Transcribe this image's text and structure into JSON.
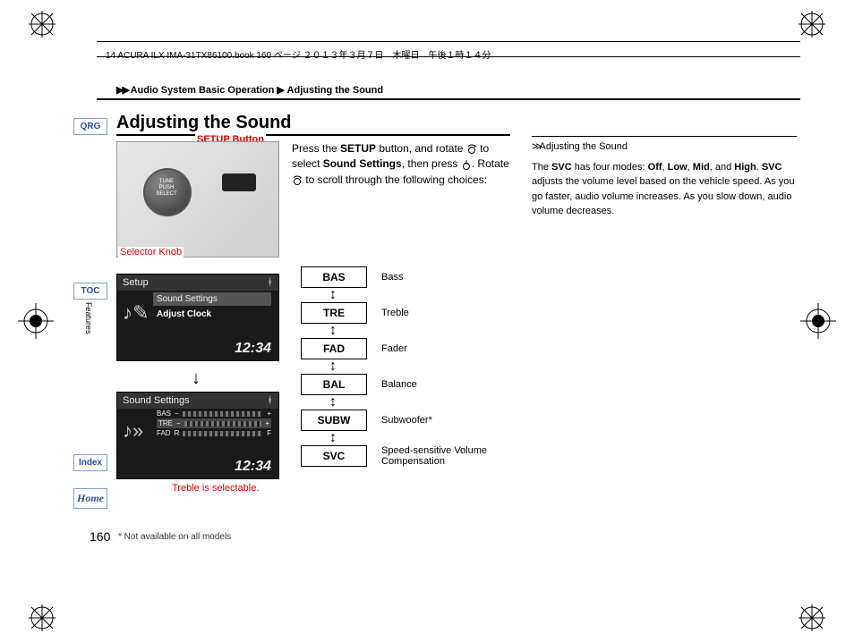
{
  "header_line": "14 ACURA ILX IMA-31TX86100.book  160 ページ  ２０１３年３月７日　木曜日　午後１時１４分",
  "breadcrumb": {
    "arrows": "▶▶",
    "a": "Audio System Basic Operation",
    "b": "Adjusting the Sound"
  },
  "nav": {
    "qrg": "QRG",
    "toc": "TOC",
    "index": "Index",
    "home": "Home",
    "side": "Features"
  },
  "title": "Adjusting the Sound",
  "labels": {
    "setup": "SETUP Button",
    "selector": "Selector Knob",
    "treble_note": "Treble is selectable."
  },
  "screens": {
    "setup": {
      "title": "Setup",
      "item_hl": "Sound Settings",
      "item_bold": "Adjust Clock",
      "time": "12:34"
    },
    "sound": {
      "title": "Sound Settings",
      "rows": [
        "BAS",
        "TRE",
        "FAD"
      ],
      "time": "12:34"
    }
  },
  "body": {
    "l1a": "Press the ",
    "l1b": "SETUP",
    "l1c": " button, and rotate ",
    "l2a": " to select ",
    "l2b": "Sound Settings",
    "l2c": ", then press ",
    "l3a": ". Rotate ",
    "l3b": " to scroll through the following choices:"
  },
  "flow": [
    {
      "code": "BAS",
      "label": "Bass"
    },
    {
      "code": "TRE",
      "label": "Treble"
    },
    {
      "code": "FAD",
      "label": "Fader"
    },
    {
      "code": "BAL",
      "label": "Balance"
    },
    {
      "code": "SUBW",
      "label": "Subwoofer*"
    },
    {
      "code": "SVC",
      "label": "Speed-sensitive Volume Compensation"
    }
  ],
  "sidebar": {
    "head": "Adjusting the Sound",
    "p": "The SVC has four modes: Off, Low, Mid, and High. SVC adjusts the volume level based on the vehicle speed. As you go faster, audio volume increases. As you slow down, audio volume decreases.",
    "bolds": [
      "SVC",
      "Off",
      "Low",
      "Mid",
      "High",
      "SVC"
    ]
  },
  "page": "160",
  "footnote": "* Not available on all models"
}
